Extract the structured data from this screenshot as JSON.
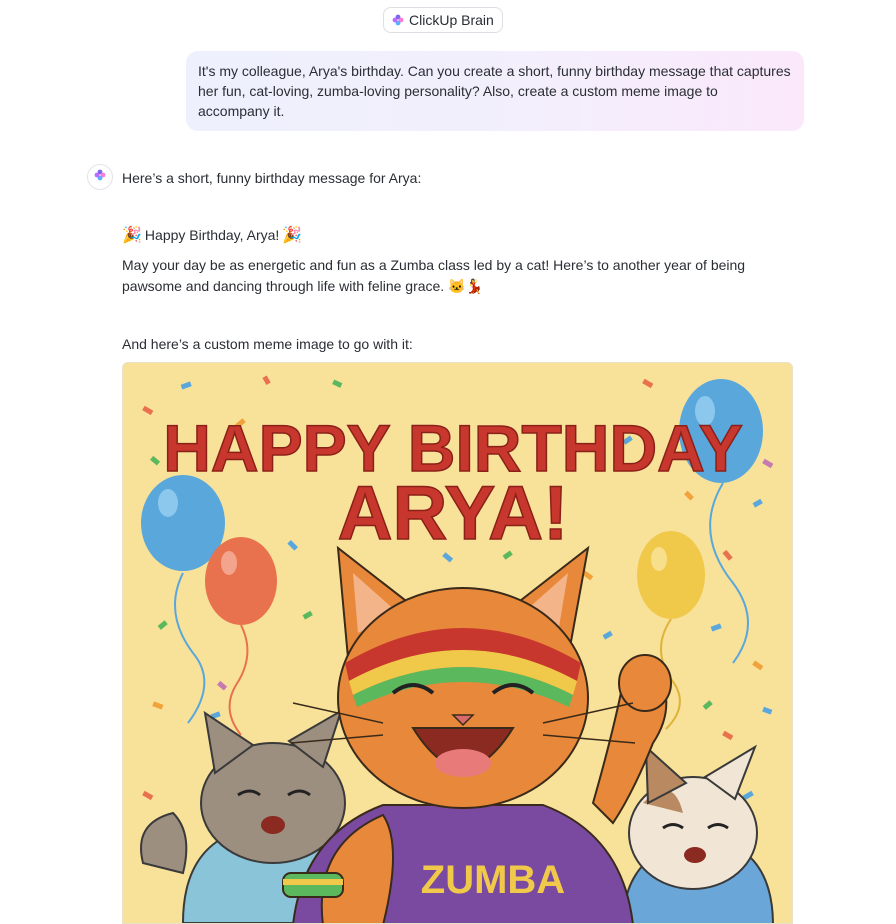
{
  "header": {
    "badge_label": "ClickUp Brain",
    "badge_icon": "clickup-brain-icon"
  },
  "user_message": {
    "text": "It's my colleague, Arya's birthday. Can you create a short, funny birthday message that captures her fun, cat-loving, zumba-loving personality? Also, create a custom meme image to accompany it."
  },
  "assistant": {
    "avatar_icon": "clickup-brain-icon",
    "intro": "Here’s a short, funny birthday message for Arya:",
    "headline_emoji": "🎉",
    "headline": "Happy Birthday, Arya!",
    "message": "May your day be as energetic and fun as a Zumba class led by a cat! Here’s to another year of being pawsome and dancing through life with feline grace. 🐱💃",
    "meme_intro": "And here’s a custom meme image to go with it:"
  },
  "meme": {
    "title_line1": "HAPPY BIRTHDAY",
    "title_line2": "ARYA!",
    "shirt_text": "ZUMBA"
  },
  "colors": {
    "meme_background": "#f8e29a",
    "title_red": "#c8372d",
    "cat_orange": "#e8883a",
    "shirt_purple": "#7a4aa0",
    "balloon_blue": "#5aa7dc",
    "balloon_red": "#e8724e",
    "balloon_yellow": "#f1c94a"
  }
}
